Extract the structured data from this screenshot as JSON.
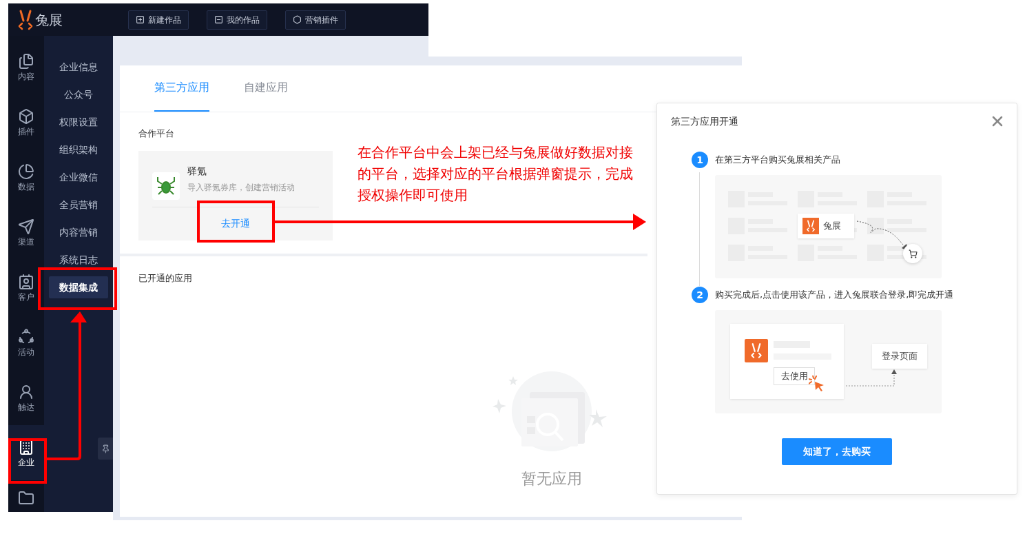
{
  "app": {
    "logo_text": "兔展",
    "top_buttons": [
      "新建作品",
      "我的作品",
      "营销插件"
    ],
    "rail": [
      {
        "label": "内容",
        "selected": false
      },
      {
        "label": "插件",
        "selected": false
      },
      {
        "label": "数据",
        "selected": false
      },
      {
        "label": "渠道",
        "selected": false
      },
      {
        "label": "客户",
        "selected": false
      },
      {
        "label": "活动",
        "selected": false
      },
      {
        "label": "触达",
        "selected": false
      },
      {
        "label": "企业",
        "selected": true
      }
    ],
    "submenu": [
      {
        "label": "企业信息",
        "selected": false
      },
      {
        "label": "公众号",
        "selected": false
      },
      {
        "label": "权限设置",
        "selected": false
      },
      {
        "label": "组织架构",
        "selected": false
      },
      {
        "label": "企业微信",
        "selected": false
      },
      {
        "label": "全员营销",
        "selected": false
      },
      {
        "label": "内容营销",
        "selected": false
      },
      {
        "label": "系统日志",
        "selected": false
      },
      {
        "label": "数据集成",
        "selected": true
      }
    ],
    "tabs": [
      {
        "label": "第三方应用",
        "selected": true
      },
      {
        "label": "自建应用",
        "selected": false
      }
    ],
    "partner_section": {
      "title": "合作平台",
      "card": {
        "name": "驿氪",
        "description": "导入驿氪券库，创建营销活动",
        "action": "去开通"
      }
    },
    "enabled_section": {
      "title": "已开通的应用",
      "empty_text": "暂无应用"
    }
  },
  "annotation": {
    "note": "在合作平台中会上架已经与兔展做好数据对接的平台，选择对应的平台根据弹窗提示，完成授权操作即可使用"
  },
  "modal": {
    "title": "第三方应用开通",
    "steps": [
      {
        "number": "1",
        "text": "在第三方平台购买兔展相关产品"
      },
      {
        "number": "2",
        "text": "购买完成后,点击使用该产品，进入兔展联合登录,即完成开通"
      }
    ],
    "product_card_label": "兔展",
    "use_button": "去使用",
    "login_page_label": "登录页面",
    "confirm_button": "知道了，去购买"
  }
}
